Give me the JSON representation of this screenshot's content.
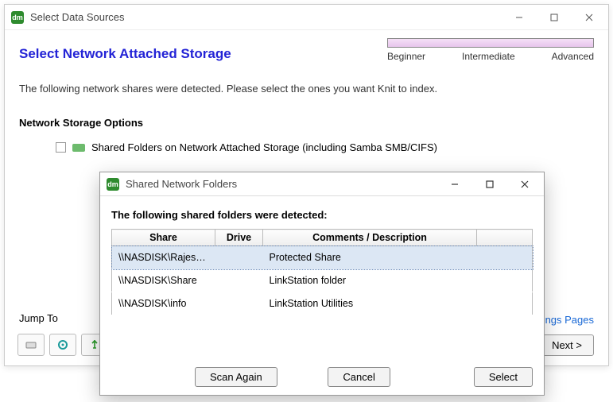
{
  "window": {
    "title": "Select Data Sources"
  },
  "page": {
    "heading": "Select Network Attached Storage",
    "levels": {
      "beginner": "Beginner",
      "intermediate": "Intermediate",
      "advanced": "Advanced"
    },
    "intro": "The following network shares were detected. Please select the ones you want Knit to index.",
    "section_title": "Network Storage Options",
    "option_label": "Shared Folders on Network Attached Storage (including Samba SMB/CIFS)",
    "jump_to": "Jump To",
    "settings_link": "ngs Pages",
    "next": "Next  >"
  },
  "modal": {
    "title": "Shared Network Folders",
    "intro": "The following shared folders were detected:",
    "columns": {
      "share": "Share",
      "drive": "Drive",
      "desc": "Comments / Description"
    },
    "rows": [
      {
        "share": "\\\\NASDISK\\Rajes…",
        "drive": "",
        "desc": "Protected Share",
        "selected": true
      },
      {
        "share": "\\\\NASDISK\\Share",
        "drive": "",
        "desc": "LinkStation folder",
        "selected": false
      },
      {
        "share": "\\\\NASDISK\\info",
        "drive": "",
        "desc": "LinkStation Utilities",
        "selected": false
      }
    ],
    "buttons": {
      "scan": "Scan Again",
      "cancel": "Cancel",
      "select": "Select"
    }
  }
}
